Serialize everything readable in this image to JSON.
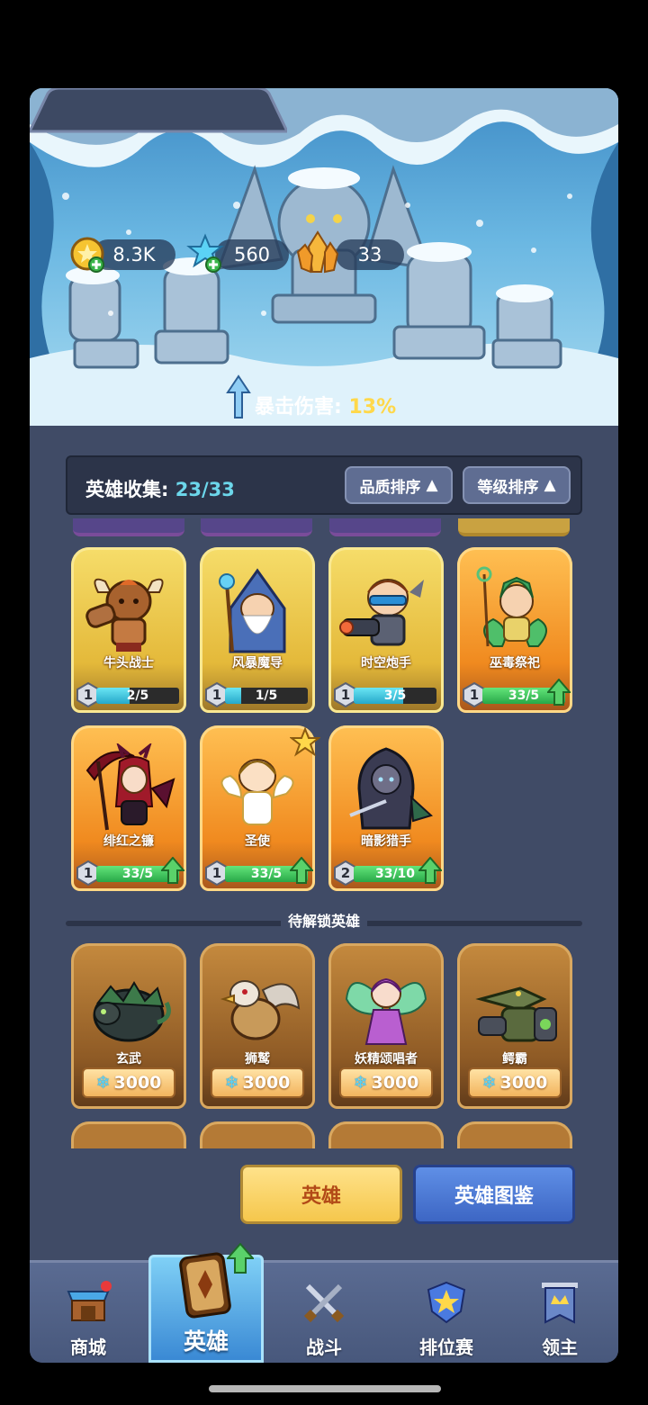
{
  "resources": {
    "gold": "8.3K",
    "gems": "560",
    "crystals": "33"
  },
  "buff": {
    "label": "暴击伤害:",
    "value": "13%"
  },
  "collection": {
    "label": "英雄收集:",
    "count": "23/33",
    "sort_quality": "品质排序",
    "sort_level": "等级排序"
  },
  "heroes": [
    {
      "name": "牛头战士",
      "level": "1",
      "progress": "2/5",
      "fill": 0.4,
      "rarity": "gold"
    },
    {
      "name": "风暴魔导",
      "level": "1",
      "progress": "1/5",
      "fill": 0.2,
      "rarity": "gold"
    },
    {
      "name": "时空炮手",
      "level": "1",
      "progress": "3/5",
      "fill": 0.6,
      "rarity": "gold"
    },
    {
      "name": "巫毒祭祀",
      "level": "1",
      "progress": "33/5",
      "fill": 1.0,
      "rarity": "orange",
      "upgrade": true
    },
    {
      "name": "绯红之镰",
      "level": "1",
      "progress": "33/5",
      "fill": 1.0,
      "rarity": "orange",
      "upgrade": true
    },
    {
      "name": "圣使",
      "level": "1",
      "progress": "33/5",
      "fill": 1.0,
      "rarity": "orange",
      "upgrade": true,
      "starred": true
    },
    {
      "name": "暗影猎手",
      "level": "2",
      "progress": "33/10",
      "fill": 1.0,
      "rarity": "orange",
      "upgrade": true
    }
  ],
  "locked": {
    "title": "待解锁英雄",
    "heroes": [
      {
        "name": "玄武",
        "cost": "3000"
      },
      {
        "name": "狮鹫",
        "cost": "3000"
      },
      {
        "name": "妖精颂唱者",
        "cost": "3000"
      },
      {
        "name": "鳄霸",
        "cost": "3000"
      }
    ]
  },
  "buttons": {
    "hero": "英雄",
    "dex": "英雄图鉴"
  },
  "tabs": {
    "shop": "商城",
    "hero": "英雄",
    "battle": "战斗",
    "ranked": "排位赛",
    "lord": "领主"
  },
  "colors": {
    "panel": "#404b66",
    "accent_gold": "#ffd84a",
    "accent_cyan": "#6cd6ea",
    "active_tab": "#3a89d4"
  }
}
